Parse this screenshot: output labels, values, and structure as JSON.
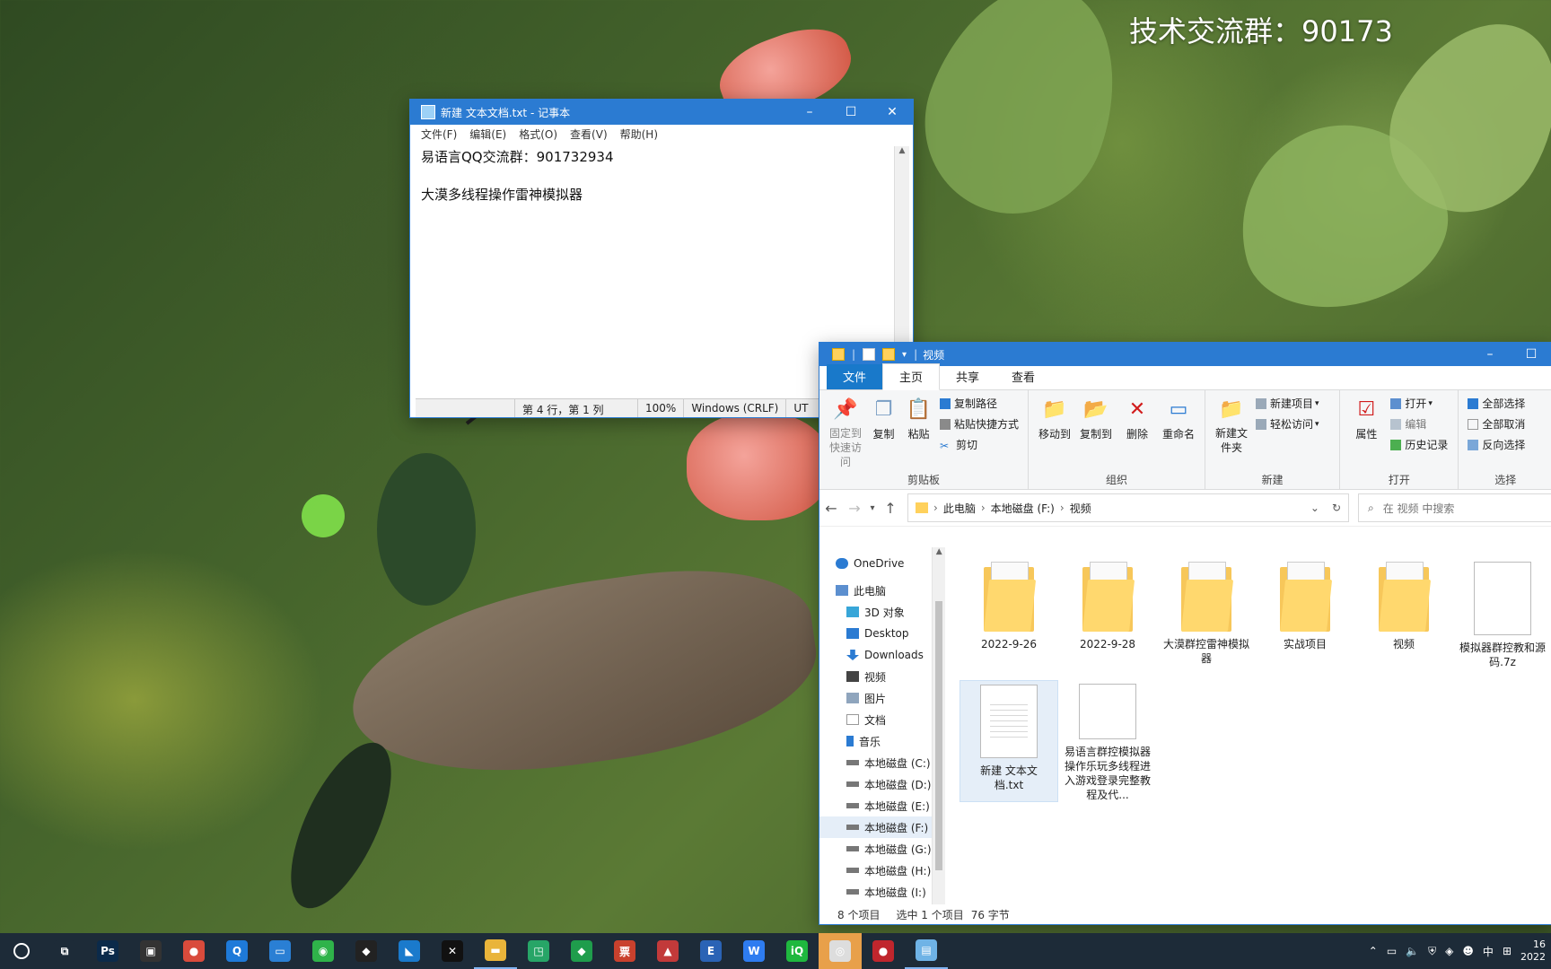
{
  "watermark": "技术交流群：90173",
  "notepad": {
    "title": "新建 文本文档.txt - 记事本",
    "menu": [
      "文件(F)",
      "编辑(E)",
      "格式(O)",
      "查看(V)",
      "帮助(H)"
    ],
    "lines": [
      "易语言QQ交流群：901732934",
      "",
      "大漠多线程操作雷神模拟器"
    ],
    "status": {
      "position": "第 4 行，第 1 列",
      "zoom": "100%",
      "eol": "Windows (CRLF)",
      "encoding": "UT"
    }
  },
  "explorer": {
    "title": "视频",
    "tabs": [
      "文件",
      "主页",
      "共享",
      "查看"
    ],
    "ribbon": {
      "clipboard": {
        "name": "剪贴板",
        "pin": "固定到快速访问",
        "copy": "复制",
        "paste": "粘贴",
        "copy_path": "复制路径",
        "paste_shortcut": "粘贴快捷方式",
        "cut": "剪切"
      },
      "organize": {
        "name": "组织",
        "move_to": "移动到",
        "copy_to": "复制到",
        "delete": "删除",
        "rename": "重命名"
      },
      "new": {
        "name": "新建",
        "new_folder": "新建文件夹",
        "new_item": "新建项目",
        "easy_access": "轻松访问"
      },
      "open": {
        "name": "打开",
        "properties": "属性",
        "open": "打开",
        "edit": "编辑",
        "history": "历史记录"
      },
      "select": {
        "name": "选择",
        "select_all": "全部选择",
        "select_none": "全部取消",
        "invert": "反向选择"
      }
    },
    "address": [
      "此电脑",
      "本地磁盘 (F:)",
      "视频"
    ],
    "search_placeholder": "在 视频 中搜索",
    "nav": [
      {
        "label": "OneDrive",
        "top": true,
        "icon": "cloud-icon"
      },
      {
        "label": "此电脑",
        "top": true,
        "icon": "computer-icon"
      },
      {
        "label": "3D 对象",
        "icon": "cube-icon"
      },
      {
        "label": "Desktop",
        "icon": "desktop-icon"
      },
      {
        "label": "Downloads",
        "icon": "download-icon"
      },
      {
        "label": "视频",
        "icon": "video-icon"
      },
      {
        "label": "图片",
        "icon": "picture-icon"
      },
      {
        "label": "文档",
        "icon": "document-icon"
      },
      {
        "label": "音乐",
        "icon": "music-icon"
      },
      {
        "label": "本地磁盘 (C:)",
        "icon": "drive-icon"
      },
      {
        "label": "本地磁盘 (D:)",
        "icon": "drive-icon"
      },
      {
        "label": "本地磁盘 (E:)",
        "icon": "drive-icon"
      },
      {
        "label": "本地磁盘 (F:)",
        "icon": "drive-icon",
        "selected": true
      },
      {
        "label": "本地磁盘 (G:)",
        "icon": "drive-icon"
      },
      {
        "label": "本地磁盘 (H:)",
        "icon": "drive-icon"
      },
      {
        "label": "本地磁盘 (I:)",
        "icon": "drive-icon"
      }
    ],
    "files": [
      {
        "name": "2022-9-26",
        "type": "folder"
      },
      {
        "name": "2022-9-28",
        "type": "folder"
      },
      {
        "name": "大漠群控雷神模拟器",
        "type": "folder"
      },
      {
        "name": "实战项目",
        "type": "folder"
      },
      {
        "name": "视频",
        "type": "folder"
      },
      {
        "name": "模拟器群控教和源码.7z",
        "type": "archive"
      },
      {
        "name": "新建 文本文档.txt",
        "type": "text",
        "selected": true
      },
      {
        "name": "易语言群控模拟器操作乐玩多线程进入游戏登录完整教程及代...",
        "type": "file"
      }
    ],
    "status": {
      "count": "8 个项目",
      "selection": "选中 1 个项目",
      "size": "76 字节"
    }
  },
  "taskbar": {
    "apps": [
      {
        "name": "task-view",
        "label": "⧉",
        "color": "#1d2b38"
      },
      {
        "name": "photoshop",
        "label": "Ps",
        "color": "#0b2a4a"
      },
      {
        "name": "app-dark",
        "label": "▣",
        "color": "#333"
      },
      {
        "name": "chrome",
        "label": "●",
        "color": "#d94b3c"
      },
      {
        "name": "browser-q",
        "label": "Q",
        "color": "#1e7ad9"
      },
      {
        "name": "remote",
        "label": "▭",
        "color": "#2a7fd4"
      },
      {
        "name": "wechat",
        "label": "◉",
        "color": "#2fb34a"
      },
      {
        "name": "qq",
        "label": "◆",
        "color": "#222"
      },
      {
        "name": "vscode",
        "label": "◣",
        "color": "#1a7acc"
      },
      {
        "name": "capcut",
        "label": "✕",
        "color": "#111"
      },
      {
        "name": "file-explorer",
        "label": "▬",
        "color": "#e9b43a",
        "active": true
      },
      {
        "name": "green-app",
        "label": "◳",
        "color": "#27a567"
      },
      {
        "name": "diamond-app",
        "label": "◆",
        "color": "#1f9d4c"
      },
      {
        "name": "fapiao",
        "label": "票",
        "color": "#c9412d"
      },
      {
        "name": "triangle-app",
        "label": "▲",
        "color": "#c23a3a"
      },
      {
        "name": "e-app",
        "label": "E",
        "color": "#2a63b5"
      },
      {
        "name": "wps",
        "label": "W",
        "color": "#2e7cf0"
      },
      {
        "name": "iqiyi",
        "label": "iQ",
        "color": "#1fb83f"
      },
      {
        "name": "recorder-circle",
        "label": "◎",
        "color": "#ddd",
        "highlight": true
      },
      {
        "name": "record-red",
        "label": "●",
        "color": "#c0262d"
      },
      {
        "name": "notepad",
        "label": "▤",
        "color": "#6fb3e6",
        "active": true
      }
    ],
    "ime": "中",
    "clock_time": "16",
    "clock_date": "2022"
  }
}
